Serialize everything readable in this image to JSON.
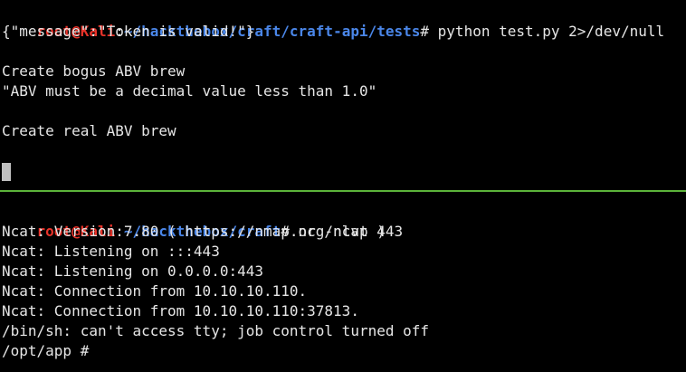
{
  "colors": {
    "background": "#000000",
    "text": "#e6e6e6",
    "prompt_user": "#e8332a",
    "prompt_path": "#4a86e8",
    "divider": "#5bb33a",
    "cursor": "#bfbfbf"
  },
  "top_pane": {
    "prompt": {
      "user_host": "root@Kali",
      "colon": ":",
      "path": "~/hackthebox/craft/craft-api/tests",
      "hash": "#",
      "command": " python test.py 2>/dev/null"
    },
    "output": [
      "{\"message\":\"Token is valid!\"}",
      "",
      "Create bogus ABV brew",
      "\"ABV must be a decimal value less than 1.0\"",
      "",
      "Create real ABV brew"
    ]
  },
  "bottom_pane": {
    "prompt": {
      "user_host": "root@Kali",
      "colon": ":",
      "path": "~/hackthebox/craft",
      "hash": "#",
      "command": " nc -nlvp 443"
    },
    "output": [
      "Ncat: Version 7.80 ( https://nmap.org/ncat )",
      "Ncat: Listening on :::443",
      "Ncat: Listening on 0.0.0.0:443",
      "Ncat: Connection from 10.10.10.110.",
      "Ncat: Connection from 10.10.10.110:37813.",
      "/bin/sh: can't access tty; job control turned off",
      "/opt/app # "
    ]
  }
}
